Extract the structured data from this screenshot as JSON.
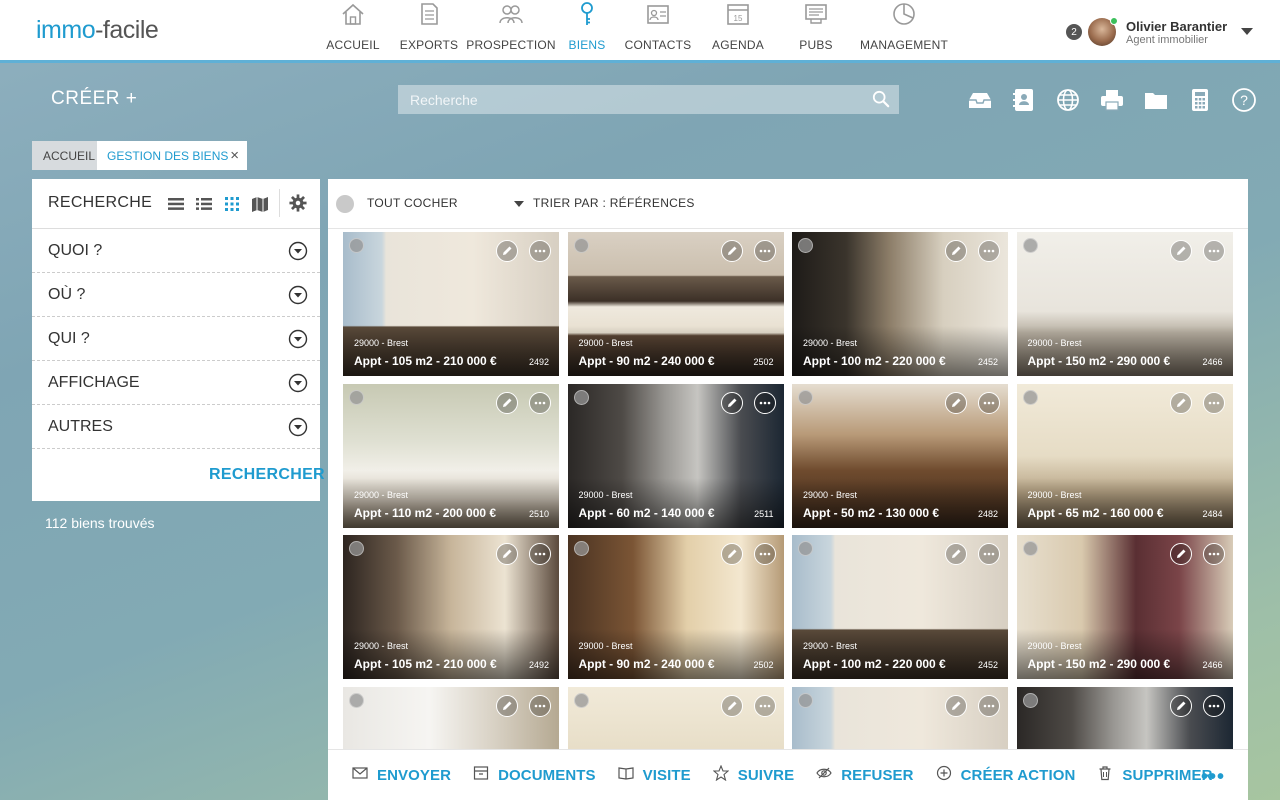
{
  "app": {
    "logo_part1": "immo",
    "logo_part2": "-facile"
  },
  "nav": [
    {
      "label": "ACCUEIL",
      "icon": "home-icon",
      "active": false
    },
    {
      "label": "EXPORTS",
      "icon": "document-icon",
      "active": false
    },
    {
      "label": "PROSPECTION",
      "icon": "people-icon",
      "active": false
    },
    {
      "label": "BIENS",
      "icon": "key-icon",
      "active": true
    },
    {
      "label": "CONTACTS",
      "icon": "contact-card-icon",
      "active": false
    },
    {
      "label": "AGENDA",
      "icon": "calendar-icon",
      "active": false
    },
    {
      "label": "PUBS",
      "icon": "newspaper-icon",
      "active": false
    },
    {
      "label": "MANAGEMENT",
      "icon": "pie-chart-icon",
      "active": false
    }
  ],
  "agenda_day": "15",
  "user": {
    "notifications": "2",
    "name": "Olivier Barantier",
    "role": "Agent immobilier"
  },
  "toolbar": {
    "create_label": "CRÉER +",
    "search_placeholder": "Recherche",
    "tools": [
      "inbox-icon",
      "address-book-icon",
      "globe-icon",
      "printer-icon",
      "folder-icon",
      "calculator-icon",
      "help-icon"
    ]
  },
  "breadcrumb": {
    "home": "ACCUEIL",
    "current": "GESTION DES BIENS",
    "close": "×"
  },
  "search_panel": {
    "title": "RECHERCHE",
    "filters": [
      "QUOI ?",
      "OÙ ?",
      "QUI ?",
      "AFFICHAGE",
      "AUTRES"
    ],
    "submit": "RECHERCHER",
    "results_count": "112 biens trouvés"
  },
  "listing": {
    "check_all": "TOUT COCHER",
    "sort": "TRIER PAR : RÉFÉRENCES",
    "cards": [
      {
        "city": "29000 - Brest",
        "title": "Appt - 105 m2 - 210 000 €",
        "ref": "2492",
        "scene": "living-bright"
      },
      {
        "city": "29000 - Brest",
        "title": "Appt - 90 m2 - 240 000 €",
        "ref": "2502",
        "scene": "kitchen-living"
      },
      {
        "city": "29000 - Brest",
        "title": "Appt - 100 m2 - 220 000 €",
        "ref": "2452",
        "scene": "modern-dark"
      },
      {
        "city": "29000 - Brest",
        "title": "Appt - 150 m2 - 290 000 €",
        "ref": "2466",
        "scene": "white-loft"
      },
      {
        "city": "29000 - Brest",
        "title": "Appt - 110 m2 - 200 000 €",
        "ref": "2510",
        "scene": "living-green"
      },
      {
        "city": "29000 - Brest",
        "title": "Appt - 60 m2 - 140 000 €",
        "ref": "2511",
        "scene": "stairs-dark"
      },
      {
        "city": "29000 - Brest",
        "title": "Appt - 50 m2 - 130 000 €",
        "ref": "2482",
        "scene": "library"
      },
      {
        "city": "29000 - Brest",
        "title": "Appt - 65 m2 - 160 000 €",
        "ref": "2484",
        "scene": "classic-cream"
      },
      {
        "city": "29000 - Brest",
        "title": "Appt - 105 m2 - 210 000 €",
        "ref": "2492",
        "scene": "fireplace"
      },
      {
        "city": "29000 - Brest",
        "title": "Appt - 90 m2 - 240 000 €",
        "ref": "2502",
        "scene": "tv-wood"
      },
      {
        "city": "29000 - Brest",
        "title": "Appt - 100 m2 - 220 000 €",
        "ref": "2452",
        "scene": "living-bright"
      },
      {
        "city": "29000 - Brest",
        "title": "Appt - 150 m2 - 290 000 €",
        "ref": "2466",
        "scene": "parisian"
      },
      {
        "city": "",
        "title": "",
        "ref": "",
        "scene": "white-room"
      },
      {
        "city": "",
        "title": "",
        "ref": "",
        "scene": "classic-cream"
      },
      {
        "city": "",
        "title": "",
        "ref": "",
        "scene": "living-bright"
      },
      {
        "city": "",
        "title": "",
        "ref": "",
        "scene": "stairs-dark"
      }
    ]
  },
  "actions": [
    {
      "label": "ENVOYER",
      "icon": "envelope-icon"
    },
    {
      "label": "DOCUMENTS",
      "icon": "archive-box-icon"
    },
    {
      "label": "VISITE",
      "icon": "open-book-icon"
    },
    {
      "label": "SUIVRE",
      "icon": "star-icon"
    },
    {
      "label": "REFUSER",
      "icon": "eye-slash-icon"
    },
    {
      "label": "CRÉER ACTION",
      "icon": "plus-circle-icon"
    },
    {
      "label": "SUPPRIMER",
      "icon": "trash-icon"
    }
  ],
  "more_actions": "•••",
  "colors": {
    "accent": "#1f9bcf",
    "nav_underline": "#5fb0d6"
  }
}
